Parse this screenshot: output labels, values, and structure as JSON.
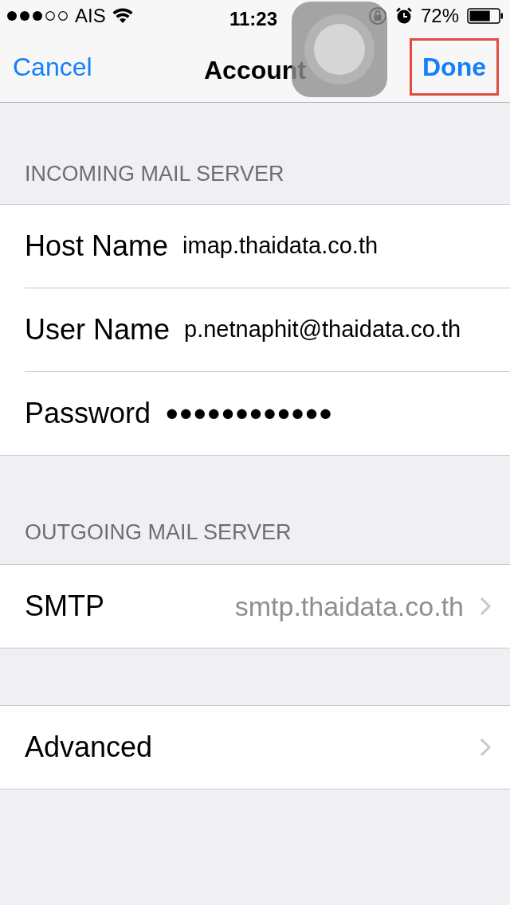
{
  "status_bar": {
    "carrier": "AIS",
    "time": "11:23",
    "battery": "72%"
  },
  "nav": {
    "cancel": "Cancel",
    "title": "Account",
    "done": {
      "label": "Done",
      "highlighted": true
    }
  },
  "sections": [
    {
      "header": "INCOMING MAIL SERVER",
      "rows": [
        {
          "kind": "field",
          "label": "Host Name",
          "value": "imap.thaidata.co.th"
        },
        {
          "kind": "field",
          "label": "User Name",
          "value": "p.netnaphit@thaidata.co.th"
        },
        {
          "kind": "field",
          "label": "Password",
          "value": "●●●●●●●●●●●●"
        }
      ]
    },
    {
      "header": "OUTGOING MAIL SERVER",
      "rows": [
        {
          "kind": "link",
          "label": "SMTP",
          "value": "smtp.thaidata.co.th"
        }
      ]
    },
    {
      "rows": [
        {
          "kind": "link",
          "label": "Advanced"
        }
      ]
    }
  ]
}
